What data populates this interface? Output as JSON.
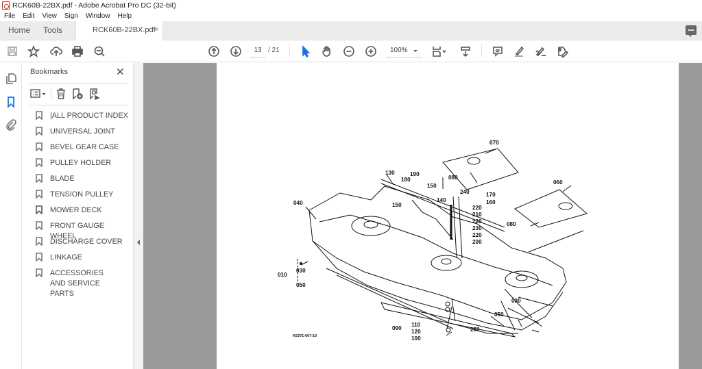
{
  "window": {
    "title": "RCK60B-22BX.pdf - Adobe Acrobat Pro DC (32-bit)"
  },
  "menu": [
    "File",
    "Edit",
    "View",
    "Sign",
    "Window",
    "Help"
  ],
  "tabs": {
    "home": "Home",
    "tools": "Tools",
    "document": "RCK60B-22BX.pdf",
    "close_glyph": "×"
  },
  "toolbar": {
    "icons": [
      "save-icon",
      "bookmark-star-icon",
      "upload-cloud-icon",
      "print-icon",
      "find-icon",
      "previous-page-icon",
      "next-page-icon",
      "select-cursor-icon",
      "hand-tool-icon",
      "zoom-out-icon",
      "zoom-in-icon",
      "page-display-icon",
      "scroll-mode-icon",
      "comment-icon",
      "highlight-icon",
      "sign-icon",
      "edit-pdf-icon"
    ],
    "page_current": "13",
    "page_total": "/ 21",
    "zoom": "100%",
    "accent": "#1473e6"
  },
  "panel": {
    "title": "Bookmarks",
    "close_glyph": "✕",
    "bookmarks": [
      "|ALL PRODUCT INDEX",
      "UNIVERSAL JOINT",
      "BEVEL GEAR CASE",
      "PULLEY HOLDER",
      "BLADE",
      "TENSION PULLEY",
      "MOWER DECK",
      "FRONT GAUGE WHEEL",
      "DISCHARGE COVER",
      "LINKAGE",
      "ACCESSORIES AND SERVICE PARTS"
    ]
  },
  "diagram": {
    "callouts": {
      "c070": "070",
      "c130": "130",
      "c190": "190",
      "c180": "180",
      "c150a": "150",
      "c080a": "080",
      "c240": "240",
      "c170": "170",
      "c160": "160",
      "c140": "140",
      "c150b": "150",
      "c040": "040",
      "c060": "060",
      "c220a": "220",
      "c210": "210",
      "c220b": "220",
      "c230": "230",
      "c220c": "220",
      "c200": "200",
      "c080b": "080",
      "c010": "010",
      "c030a": "030",
      "c050a": "050",
      "c030b": "030",
      "c050b": "050",
      "c250": "250",
      "c090": "090",
      "c110": "110",
      "c120": "120",
      "c100": "100",
      "figure_id": "K5371-007-10"
    }
  }
}
